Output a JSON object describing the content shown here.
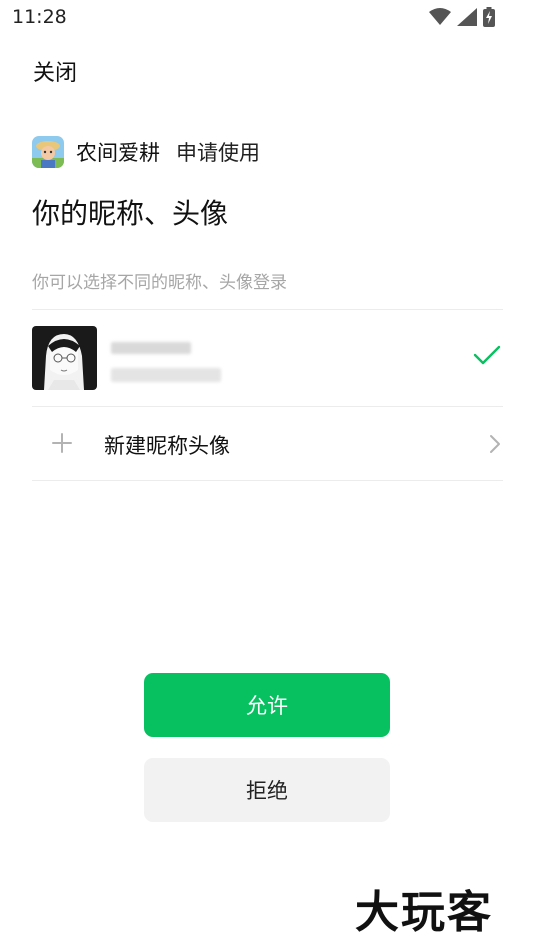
{
  "status_bar": {
    "time": "11:28",
    "icons": [
      "wifi-icon",
      "signal-icon",
      "battery-charging-icon"
    ]
  },
  "header": {
    "close_label": "关闭"
  },
  "app": {
    "icon": "farm-game-app-icon",
    "name": "农间爱耕",
    "action": "申请使用"
  },
  "title": "你的昵称、头像",
  "hint": "你可以选择不同的昵称、头像登录",
  "account": {
    "avatar": "manga-portrait-avatar",
    "selected": true,
    "selected_icon": "check-icon"
  },
  "new_profile": {
    "label": "新建昵称头像",
    "icon": "plus-icon",
    "chevron": "chevron-right-icon"
  },
  "buttons": {
    "allow": "允许",
    "deny": "拒绝"
  },
  "watermark": "大玩客",
  "colors": {
    "accent": "#07c160",
    "deny_bg": "#f2f2f2",
    "hint": "#a6a6a6"
  }
}
